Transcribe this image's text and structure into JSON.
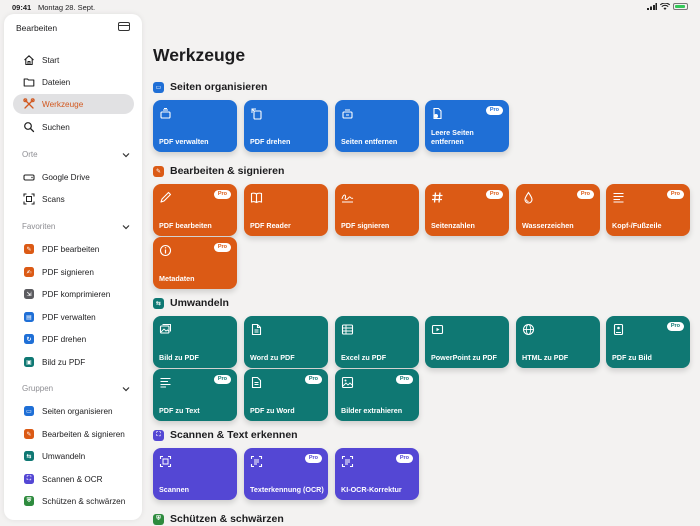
{
  "status_bar": {
    "time": "09:41",
    "date": "Montag 28. Sept."
  },
  "sidebar": {
    "header": "Bearbeiten",
    "main_items": [
      {
        "label": "Start",
        "icon": "house-icon"
      },
      {
        "label": "Dateien",
        "icon": "folder-icon"
      },
      {
        "label": "Werkzeuge",
        "icon": "tools-icon",
        "active": true
      },
      {
        "label": "Suchen",
        "icon": "magnifier-icon"
      }
    ],
    "orte": {
      "title": "Orte",
      "items": [
        {
          "label": "Google Drive",
          "icon": "drive-icon"
        },
        {
          "label": "Scans",
          "icon": "scan-icon"
        }
      ]
    },
    "favoriten": {
      "title": "Favoriten",
      "items": [
        {
          "label": "PDF bearbeiten",
          "color": "#db5a15"
        },
        {
          "label": "PDF signieren",
          "color": "#db5a15"
        },
        {
          "label": "PDF komprimieren",
          "color": "#5c5c60"
        },
        {
          "label": "PDF verwalten",
          "color": "#1f6fd6"
        },
        {
          "label": "PDF drehen",
          "color": "#1f6fd6"
        },
        {
          "label": "Bild zu PDF",
          "color": "#0f7873"
        }
      ]
    },
    "gruppen": {
      "title": "Gruppen",
      "items": [
        {
          "label": "Seiten organisieren",
          "color": "#1f6fd6"
        },
        {
          "label": "Bearbeiten & signieren",
          "color": "#db5a15"
        },
        {
          "label": "Umwandeln",
          "color": "#0f7873"
        },
        {
          "label": "Scannen & OCR",
          "color": "#5447d4"
        },
        {
          "label": "Schützen & schwärzen",
          "color": "#2e8b3e"
        }
      ]
    }
  },
  "main": {
    "title": "Werkzeuge",
    "sections": [
      {
        "title": "Seiten organisieren",
        "color": "#1f6fd6",
        "cards": [
          {
            "label": "PDF verwalten",
            "pro": "",
            "icon": "manage-pages-icon"
          },
          {
            "label": "PDF drehen",
            "pro": "",
            "icon": "rotate-page-icon"
          },
          {
            "label": "Seiten entfernen",
            "pro": "",
            "icon": "remove-pages-icon"
          },
          {
            "label": "Leere Seiten entfernen",
            "pro": "Pro",
            "icon": "blank-page-remove-icon"
          }
        ]
      },
      {
        "title": "Bearbeiten & signieren",
        "color": "#db5a15",
        "cards": [
          {
            "label": "PDF bearbeiten",
            "pro": "Pro",
            "icon": "pencil-icon"
          },
          {
            "label": "PDF Reader",
            "pro": "",
            "icon": "book-icon"
          },
          {
            "label": "PDF signieren",
            "pro": "",
            "icon": "signature-icon"
          },
          {
            "label": "Seitenzahlen",
            "pro": "Pro",
            "icon": "hashtag-icon"
          },
          {
            "label": "Wasserzeichen",
            "pro": "Pro",
            "icon": "drop-icon"
          },
          {
            "label": "Kopf-/Fußzeile",
            "pro": "Pro",
            "icon": "header-footer-icon"
          },
          {
            "label": "Metadaten",
            "pro": "Pro",
            "icon": "info-icon"
          }
        ]
      },
      {
        "title": "Umwandeln",
        "color": "#0f7873",
        "cards": [
          {
            "label": "Bild zu PDF",
            "pro": "",
            "icon": "photos-icon"
          },
          {
            "label": "Word zu PDF",
            "pro": "",
            "icon": "document-icon"
          },
          {
            "label": "Excel zu PDF",
            "pro": "",
            "icon": "table-icon"
          },
          {
            "label": "PowerPoint zu PDF",
            "pro": "",
            "icon": "presentation-icon"
          },
          {
            "label": "HTML zu PDF",
            "pro": "",
            "icon": "globe-icon"
          },
          {
            "label": "PDF zu Bild",
            "pro": "Pro",
            "icon": "image-doc-icon"
          },
          {
            "label": "PDF zu Text",
            "pro": "Pro",
            "icon": "text-lines-icon"
          },
          {
            "label": "PDF zu Word",
            "pro": "Pro",
            "icon": "word-doc-icon"
          },
          {
            "label": "Bilder extrahieren",
            "pro": "Pro",
            "icon": "extract-images-icon"
          }
        ]
      },
      {
        "title": "Scannen & Text erkennen",
        "color": "#5447d4",
        "cards": [
          {
            "label": "Scannen",
            "pro": "",
            "icon": "scan-frame-icon"
          },
          {
            "label": "Texterkennung (OCR)",
            "pro": "Pro",
            "icon": "ocr-icon"
          },
          {
            "label": "KI-OCR-Korrektur",
            "pro": "Pro",
            "icon": "ai-ocr-icon"
          }
        ]
      },
      {
        "title": "Schützen & schwärzen",
        "color": "#2e8b3e",
        "cards": []
      }
    ]
  }
}
